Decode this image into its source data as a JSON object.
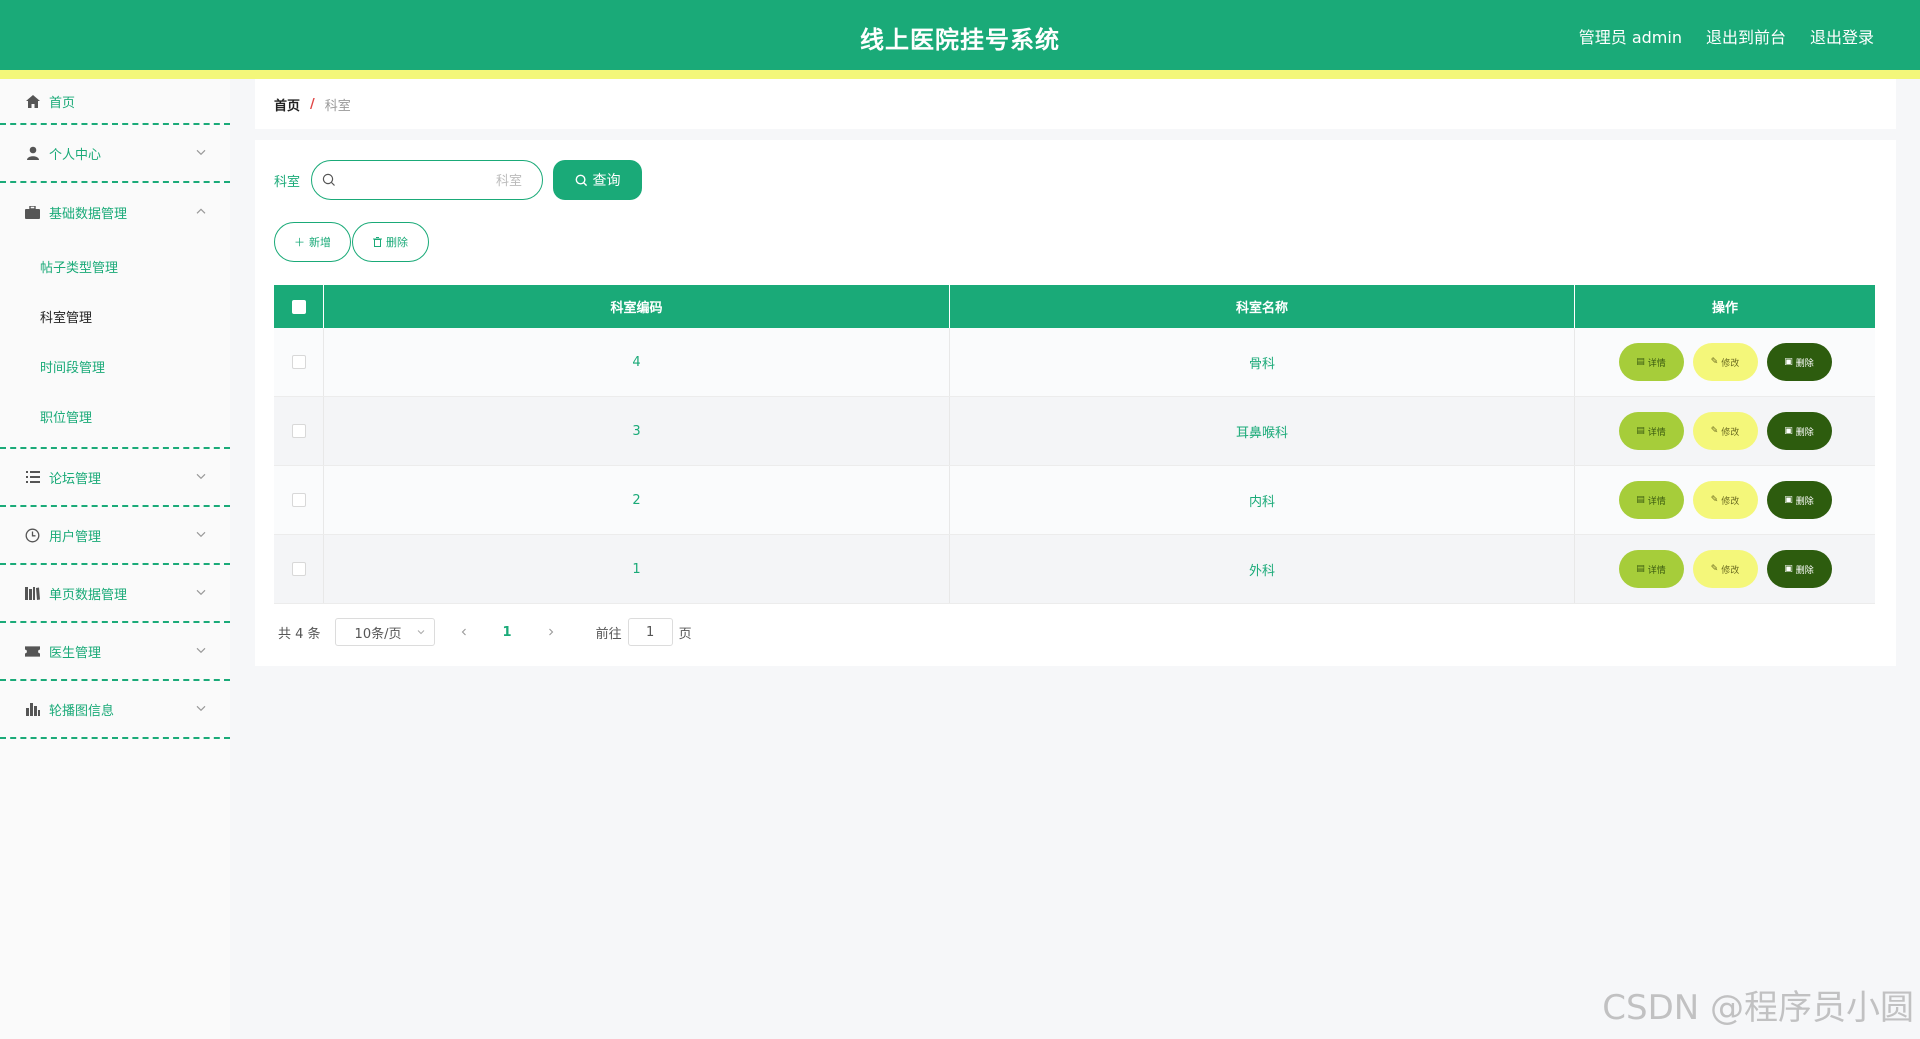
{
  "header": {
    "title": "线上医院挂号系统",
    "user": "管理员 admin",
    "front_link": "退出到前台",
    "logout": "退出登录",
    "brand_color": "#1aaa78",
    "stripe_color": "#f3f77a"
  },
  "sidebar": {
    "home": "首页",
    "personal": "个人中心",
    "basic_data": "基础数据管理",
    "sub_items": [
      "帖子类型管理",
      "科室管理",
      "时间段管理",
      "职位管理"
    ],
    "forum": "论坛管理",
    "users": "用户管理",
    "single_page": "单页数据管理",
    "doctors": "医生管理",
    "carousel": "轮播图信息"
  },
  "breadcrumb": {
    "home": "首页",
    "separator": "/",
    "current": "科室"
  },
  "search": {
    "label": "科室",
    "placeholder": "科室",
    "button": "查询"
  },
  "actions": {
    "add": "新增",
    "delete": "删除"
  },
  "table": {
    "columns": [
      "科室编码",
      "科室名称",
      "操作"
    ],
    "rows": [
      {
        "code": "4",
        "name": "骨科"
      },
      {
        "code": "3",
        "name": "耳鼻喉科"
      },
      {
        "code": "2",
        "name": "内科"
      },
      {
        "code": "1",
        "name": "外科"
      }
    ],
    "op_detail": "详情",
    "op_edit": "修改",
    "op_delete": "删除"
  },
  "pagination": {
    "total": "共 4 条",
    "page_size": "10条/页",
    "current_page": "1",
    "goto_label": "前往",
    "goto_value": "1",
    "page_suffix": "页"
  },
  "watermark": "CSDN @程序员小圆"
}
